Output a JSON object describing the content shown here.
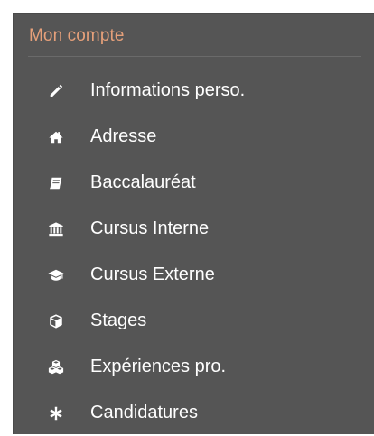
{
  "panel": {
    "title": "Mon compte",
    "title_color": "#e6a07a",
    "background": "#555555"
  },
  "menu": {
    "items": [
      {
        "label": "Informations perso.",
        "icon": "pencil-icon"
      },
      {
        "label": "Adresse",
        "icon": "home-icon"
      },
      {
        "label": "Baccalauréat",
        "icon": "book-icon"
      },
      {
        "label": "Cursus Interne",
        "icon": "institution-icon"
      },
      {
        "label": "Cursus Externe",
        "icon": "graduation-cap-icon"
      },
      {
        "label": "Stages",
        "icon": "cube-icon"
      },
      {
        "label": "Expériences pro.",
        "icon": "cubes-icon"
      },
      {
        "label": "Candidatures",
        "icon": "asterisk-icon"
      }
    ]
  }
}
